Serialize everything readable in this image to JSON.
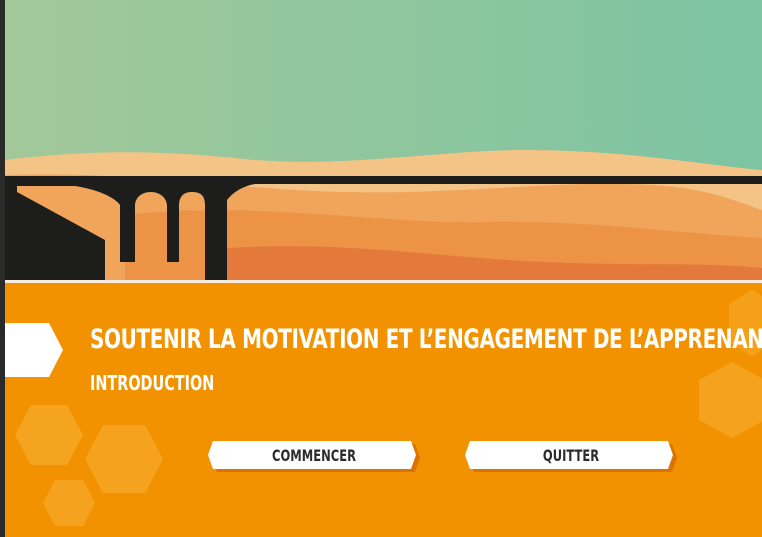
{
  "colors": {
    "sky_left": "#9ec89a",
    "sky_right": "#7bc4a0",
    "panel": "#f39200",
    "bridge": "#1d1d1b",
    "button_face": "#ffffff",
    "button_text": "#2b2b2b"
  },
  "icons": {
    "bridge": "bridge-silhouette",
    "hexagons": "hexagon-decoration",
    "title_arrow": "arrow-tab"
  },
  "title": "SOUTENIR LA MOTIVATION ET L’ENGAGEMENT DE L’APPRENANT",
  "subtitle": "INTRODUCTION",
  "buttons": {
    "start_label": "COMMENCER",
    "quit_label": "QUITTER"
  }
}
